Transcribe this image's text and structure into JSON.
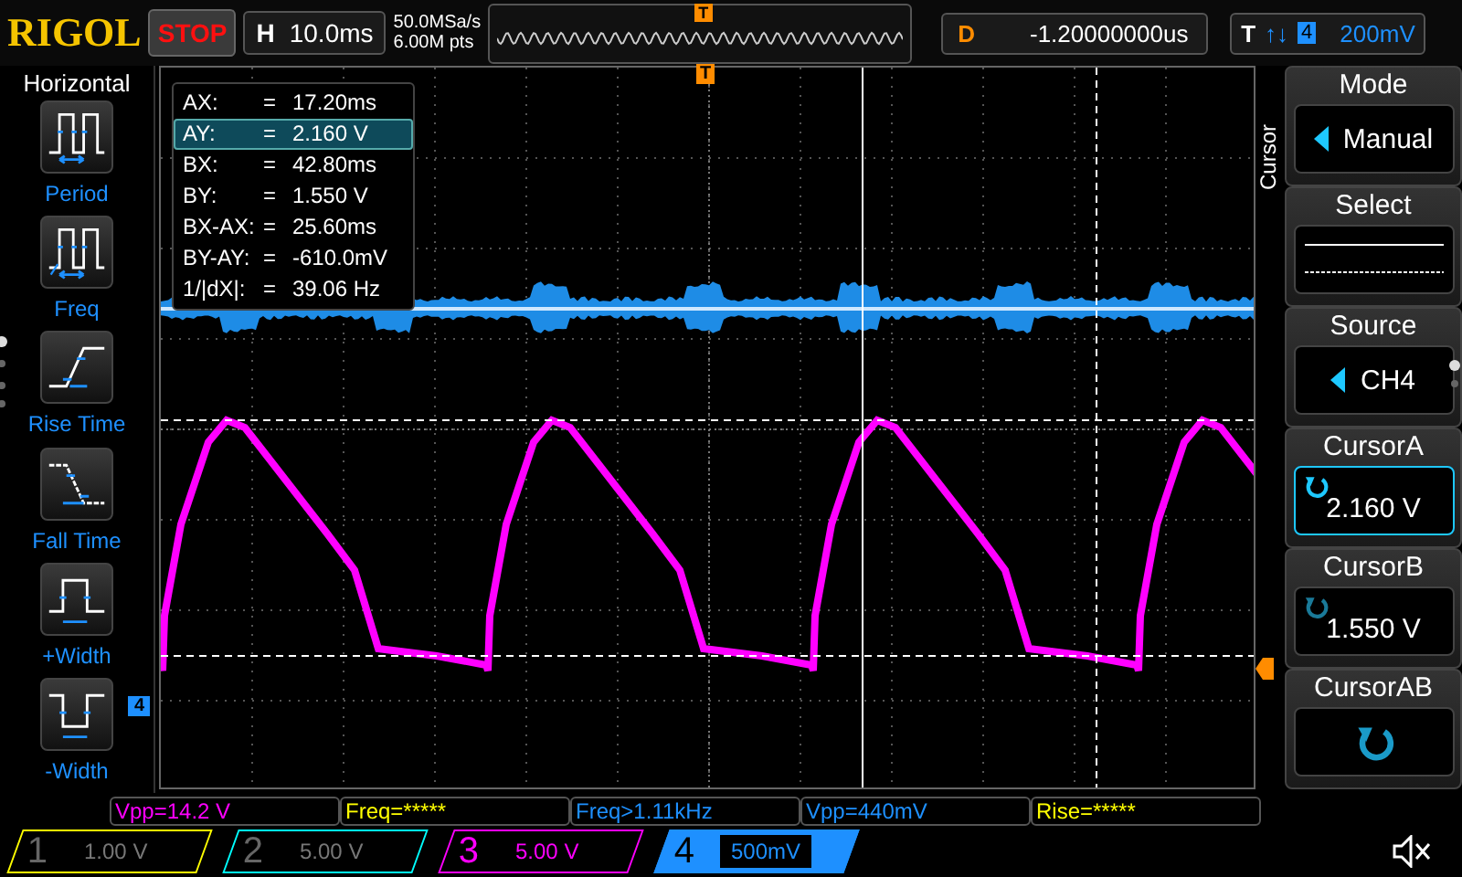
{
  "top_bar": {
    "logo": "RIGOL",
    "run_state": "STOP",
    "timebase": {
      "label": "H",
      "value": "10.0ms"
    },
    "sample_rate": "50.0MSa/s",
    "memory_depth": "6.00M pts",
    "trigger_marker": "T",
    "delay": {
      "label": "D",
      "value": "-1.20000000us"
    },
    "trigger": {
      "label": "T",
      "slope": "↑↓",
      "source": "4",
      "level": "200mV"
    }
  },
  "left_menu": {
    "title": "Horizontal",
    "items": [
      {
        "label": "Period",
        "kind": "period"
      },
      {
        "label": "Freq",
        "kind": "freq"
      },
      {
        "label": "Rise Time",
        "kind": "rise"
      },
      {
        "label": "Fall Time",
        "kind": "fall"
      },
      {
        "label": "+Width",
        "kind": "pwidth"
      },
      {
        "label": "-Width",
        "kind": "nwidth"
      }
    ]
  },
  "cursor_readout": [
    {
      "name": "AX:",
      "eq": "=",
      "value": "17.20ms",
      "selected": false
    },
    {
      "name": "AY:",
      "eq": "=",
      "value": "2.160 V",
      "selected": true
    },
    {
      "name": "BX:",
      "eq": "=",
      "value": "42.80ms",
      "selected": false
    },
    {
      "name": "BY:",
      "eq": "=",
      "value": "1.550 V",
      "selected": false
    },
    {
      "name": "BX-AX:",
      "eq": "=",
      "value": "25.60ms",
      "selected": false
    },
    {
      "name": "BY-AY:",
      "eq": "=",
      "value": "-610.0mV",
      "selected": false
    },
    {
      "name": "1/|dX|:",
      "eq": "=",
      "value": "39.06 Hz",
      "selected": false
    }
  ],
  "screen": {
    "trigger_marker": "T",
    "channel_marker": "4"
  },
  "right_menu": {
    "label": "Cursor",
    "items": [
      {
        "title": "Mode",
        "value": "Manual",
        "kind": "option",
        "selected": false
      },
      {
        "title": "Select",
        "kind": "lines",
        "selected": false
      },
      {
        "title": "Source",
        "value": "CH4",
        "kind": "option",
        "selected": false
      },
      {
        "title": "CursorA",
        "value": "2.160 V",
        "kind": "knob",
        "selected": true
      },
      {
        "title": "CursorB",
        "value": "1.550 V",
        "kind": "knob",
        "selected": false
      },
      {
        "title": "CursorAB",
        "kind": "knob",
        "selected": false
      }
    ]
  },
  "measurements": [
    {
      "text": "Vpp=14.2 V",
      "color": "#ff00ff"
    },
    {
      "text": "Freq=*****",
      "color": "#ffff00"
    },
    {
      "text": "Freq>1.11kHz",
      "color": "#1e90ff"
    },
    {
      "text": "Vpp=440mV",
      "color": "#1e90ff"
    },
    {
      "text": "Rise=*****",
      "color": "#ffff00"
    }
  ],
  "channels": [
    {
      "number": "1",
      "scale": "1.00 V",
      "color": "#ffff00",
      "on": false,
      "selected": false
    },
    {
      "number": "2",
      "scale": "5.00 V",
      "color": "#00ffff",
      "on": false,
      "selected": false
    },
    {
      "number": "3",
      "scale": "5.00 V",
      "color": "#ff00ff",
      "on": true,
      "selected": false
    },
    {
      "number": "4",
      "scale": "500mV",
      "color": "#1e90ff",
      "on": true,
      "selected": true
    }
  ]
}
